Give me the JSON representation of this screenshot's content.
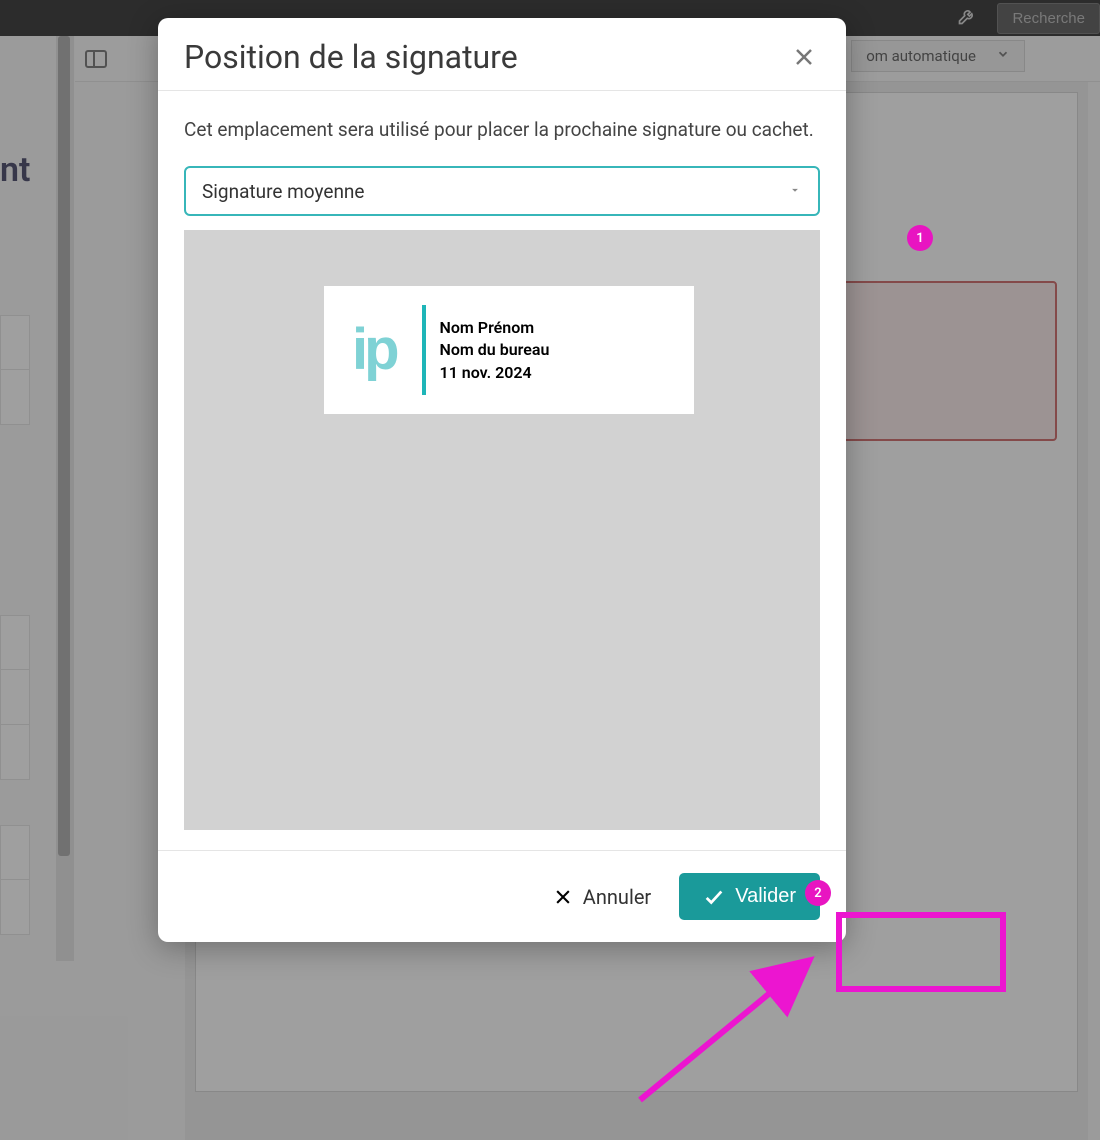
{
  "topbar": {
    "search_label": "Recherche"
  },
  "toolbar": {
    "zoom_label": "om automatique"
  },
  "sidebar": {
    "partial_text": "nt"
  },
  "modal": {
    "title": "Position de la signature",
    "description": "Cet emplacement sera utilisé pour placer la prochaine signature ou cachet.",
    "select_value": "Signature moyenne",
    "stamp": {
      "logo_text": "ip",
      "line1": "Nom Prénom",
      "line2": "Nom du bureau",
      "line3": "11 nov. 2024"
    },
    "cancel_label": "Annuler",
    "validate_label": "Valider"
  },
  "annotations": {
    "callout1": "1",
    "callout2": "2"
  }
}
